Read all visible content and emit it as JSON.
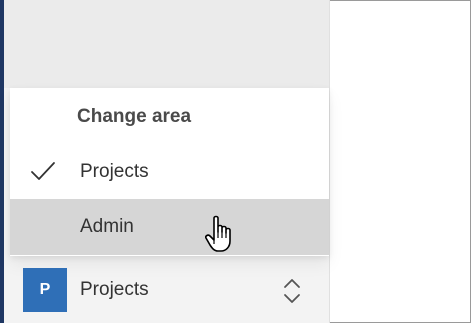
{
  "menu": {
    "header": "Change area",
    "items": [
      {
        "label": "Projects",
        "selected": true
      },
      {
        "label": "Admin",
        "selected": false,
        "hovered": true
      }
    ]
  },
  "footer": {
    "avatar_letter": "P",
    "label": "Projects"
  },
  "icons": {
    "check": "check-icon",
    "cursor": "hand-pointer-cursor-icon",
    "expand": "chevron-up-down-icon"
  },
  "colors": {
    "accent_bar": "#1f3763",
    "avatar_bg": "#2f6fb7",
    "hover_bg": "#d6d6d6"
  }
}
